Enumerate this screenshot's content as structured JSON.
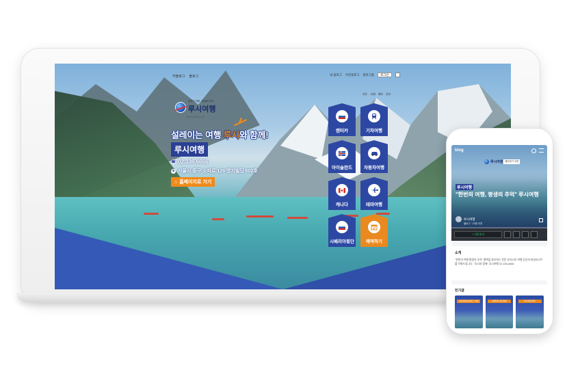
{
  "desktop": {
    "topbar_left": [
      "카블로그",
      "블로그"
    ],
    "topbar_right": [
      "내 블로그",
      "이웃블로그",
      "블로그홈"
    ],
    "login_label": "로그인",
    "subnav": [
      "지도",
      "서재",
      "메모",
      "안부"
    ],
    "logo_small": "한번의 여행 · 평생의 추억",
    "logo_main": "루시여행",
    "logo_url": "www.lusitour.com",
    "headline_pre": "설레이는 여행",
    "headline_brand": "루시",
    "headline_post": "와 함께!",
    "brand_box": "루시여행",
    "phone": "02.336.6666",
    "address": "서울시 중구 소파로 129 명지빌딩 602호",
    "home_button": "홈페이지로 가기",
    "tiles": [
      {
        "label": "렌터카",
        "icon": "russia-flag-icon"
      },
      {
        "label": "기차여행",
        "icon": "train-icon"
      },
      {
        "label": "아이슬란드",
        "icon": "iceland-flag-icon"
      },
      {
        "label": "자동차여행",
        "icon": "car-icon"
      },
      {
        "label": "캐나다",
        "icon": "canada-flag-icon"
      },
      {
        "label": "테마여행",
        "icon": "plane-icon"
      },
      {
        "label": "시베리아횡단",
        "icon": "russia-flag-icon"
      },
      {
        "label": "예약하기",
        "icon": "calendar-icon"
      }
    ]
  },
  "mobile": {
    "blog_label": "blog",
    "logo_main": "루시여행",
    "chip_label": "메인하기 이웃",
    "brand_tag": "루시여행",
    "quote": "\"한번의 여행, 평생의 추억\" 루시여행",
    "blogger_name": "루시여행",
    "blogger_meta": "블로그 · 23명 이웃",
    "neighbor_button": "+ 이웃추가",
    "intro_title": "소개",
    "intro_text": "\"한번의 여행 평생의 추억\" 행복을 창조하는 전문 유라시아 여행 당신의 버킷리스트를 이뤄드립니다. \"루시와 함께\" 루시여행 02-336-6666",
    "popular_title": "인기글",
    "card_tags": [
      "상트페테르부르크 여행",
      "시베리아 횡단열차",
      "루시여행 특가"
    ]
  },
  "colors": {
    "brand_blue": "#2d48a3",
    "accent_orange": "#e9891f"
  }
}
